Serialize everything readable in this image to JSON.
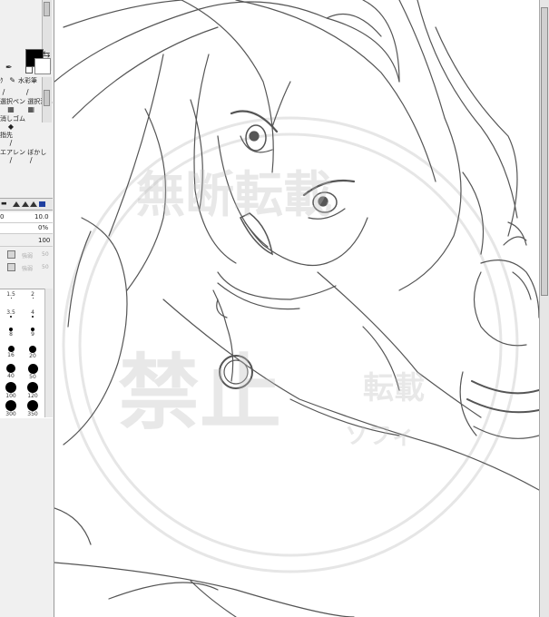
{
  "toolpanel": {
    "tools": [
      {
        "left_label": "ｸ",
        "right_label": "水彩筆"
      },
      {
        "left_label": "選択ペン",
        "right_label": "選択消し"
      },
      {
        "left_label": "消しゴム",
        "right_label": ""
      },
      {
        "left_label": "指先",
        "right_label": ""
      },
      {
        "left_label": "エアレン",
        "right_label": "ぼかし"
      }
    ],
    "size_value": "10.0",
    "min_size_value": "0",
    "density_value": "0%",
    "density_max": "100",
    "dim_label_1": "強弱",
    "dim_label_1_value": "50",
    "dim_label_2": "強弱",
    "dim_label_2_value": "50",
    "brush_sizes": [
      [
        "1.5",
        "2"
      ],
      [
        "3.5",
        "4"
      ],
      [
        "8",
        "9"
      ],
      [
        "16",
        "20"
      ],
      [
        "40",
        "50"
      ],
      [
        "100",
        "120"
      ],
      [
        "300",
        "350"
      ]
    ]
  },
  "colors": {
    "foreground": "#000000",
    "background": "#ffffff",
    "line": "#555555"
  },
  "watermark": {
    "line1": "無断転載",
    "line2": "禁止",
    "line3": "転載",
    "line4": "ソフィ"
  }
}
